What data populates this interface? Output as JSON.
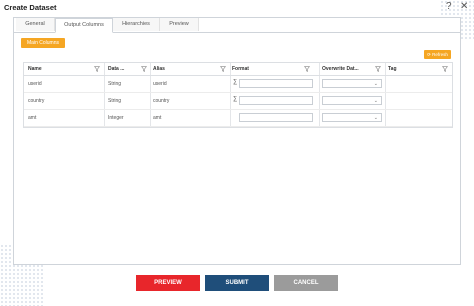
{
  "dialog": {
    "title": "Create Dataset",
    "help_label": "?",
    "close_label": "✕"
  },
  "tabs": [
    {
      "label": "General"
    },
    {
      "label": "Output Columns"
    },
    {
      "label": "Hierarchies"
    },
    {
      "label": "Preview"
    }
  ],
  "active_tab": "Output Columns",
  "main_columns_label": "Main Columns",
  "refresh_label": "⟳ Refresh",
  "grid": {
    "columns": [
      "Name",
      "Data ...",
      "Alias",
      "Format",
      "Overwrite Dat...",
      "Tag"
    ],
    "rows": [
      {
        "name": "userid",
        "type": "String",
        "alias": "userid",
        "show_sigma": true
      },
      {
        "name": "country",
        "type": "String",
        "alias": "country",
        "show_sigma": true
      },
      {
        "name": "amt",
        "type": "Integer",
        "alias": "amt",
        "show_sigma": false
      }
    ],
    "sigma_glyph": "∑",
    "select_chevron": "⌄"
  },
  "footer": {
    "preview_label": "PREVIEW",
    "submit_label": "SUBMIT",
    "cancel_label": "CANCEL"
  },
  "colors": {
    "accent_orange": "#f5a623",
    "preview_red": "#e8262b",
    "submit_navy": "#1f4e7a",
    "cancel_gray": "#9b9b9b"
  }
}
